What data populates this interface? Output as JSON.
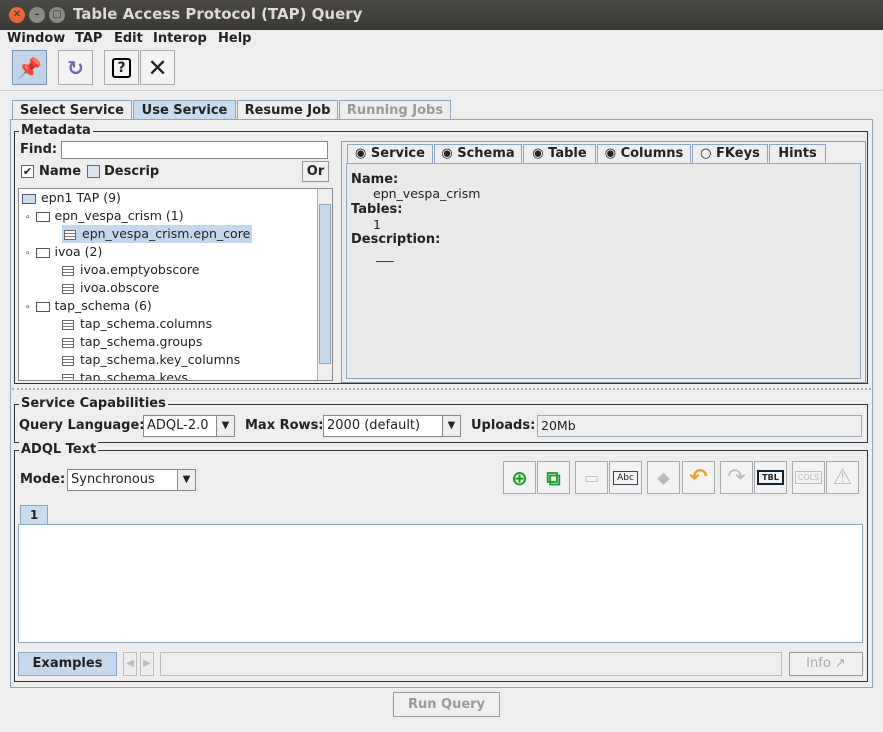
{
  "window": {
    "title": "Table Access Protocol (TAP) Query"
  },
  "menu": [
    "Window",
    "TAP",
    "Edit",
    "Interop",
    "Help"
  ],
  "toolbar": {
    "icons": [
      "pin-icon",
      "reload-icon",
      "help-icon",
      "close-icon"
    ]
  },
  "tabs": [
    {
      "label": "Select Service"
    },
    {
      "label": "Use Service",
      "selected": true
    },
    {
      "label": "Resume Job"
    },
    {
      "label": "Running Jobs",
      "disabled": true
    }
  ],
  "metadata": {
    "title": "Metadata",
    "find_label": "Find:",
    "find_value": "",
    "name_label": "Name",
    "name_checked": true,
    "descrip_label": "Descrip",
    "descrip_checked": false,
    "or_label": "Or",
    "tree": [
      {
        "label": "epn1 TAP (9)",
        "type": "root"
      },
      {
        "label": "epn_vespa_crism (1)",
        "type": "schema"
      },
      {
        "label": "epn_vespa_crism.epn_core",
        "type": "table",
        "selected": true
      },
      {
        "label": "ivoa (2)",
        "type": "schema"
      },
      {
        "label": "ivoa.emptyobscore",
        "type": "table"
      },
      {
        "label": "ivoa.obscore",
        "type": "table"
      },
      {
        "label": "tap_schema (6)",
        "type": "schema"
      },
      {
        "label": "tap_schema.columns",
        "type": "table"
      },
      {
        "label": "tap_schema.groups",
        "type": "table"
      },
      {
        "label": "tap_schema.key_columns",
        "type": "table"
      },
      {
        "label": "tap_schema.keys",
        "type": "table"
      }
    ],
    "detail_tabs": [
      {
        "label": "Service",
        "radio": true,
        "on": true
      },
      {
        "label": "Schema",
        "radio": true,
        "on": true,
        "selected": true
      },
      {
        "label": "Table",
        "radio": true,
        "on": true
      },
      {
        "label": "Columns",
        "radio": true,
        "on": true
      },
      {
        "label": "FKeys",
        "radio": true,
        "on": false
      },
      {
        "label": "Hints",
        "radio": false
      }
    ],
    "detail": {
      "name_label": "Name:",
      "name": "epn_vespa_crism",
      "tables_label": "Tables:",
      "tables": "1",
      "description_label": "Description:",
      "description": "___"
    }
  },
  "capabilities": {
    "title": "Service Capabilities",
    "lang_label": "Query Language:",
    "lang": "ADQL-2.0",
    "maxrows_label": "Max Rows:",
    "maxrows": "2000 (default)",
    "uploads_label": "Uploads:",
    "uploads": "20Mb"
  },
  "adql": {
    "title": "ADQL Text",
    "mode_label": "Mode:",
    "mode": "Synchronous",
    "text_tab": "1",
    "text": "",
    "examples_label": "Examples",
    "info_label": "Info",
    "actions": [
      {
        "icon": "add-tab-icon",
        "enabled": true
      },
      {
        "icon": "copy-tab-icon",
        "enabled": true
      },
      {
        "icon": "remove-tab-icon",
        "enabled": false
      },
      {
        "icon": "rename-tab-icon",
        "enabled": true
      },
      {
        "icon": "clear-icon",
        "enabled": false
      },
      {
        "icon": "undo-icon",
        "enabled": true
      },
      {
        "icon": "redo-icon",
        "enabled": false
      },
      {
        "icon": "insert-table-icon",
        "enabled": true
      },
      {
        "icon": "insert-columns-icon",
        "enabled": false
      },
      {
        "icon": "warning-icon",
        "enabled": false
      }
    ]
  },
  "run_query_label": "Run Query"
}
